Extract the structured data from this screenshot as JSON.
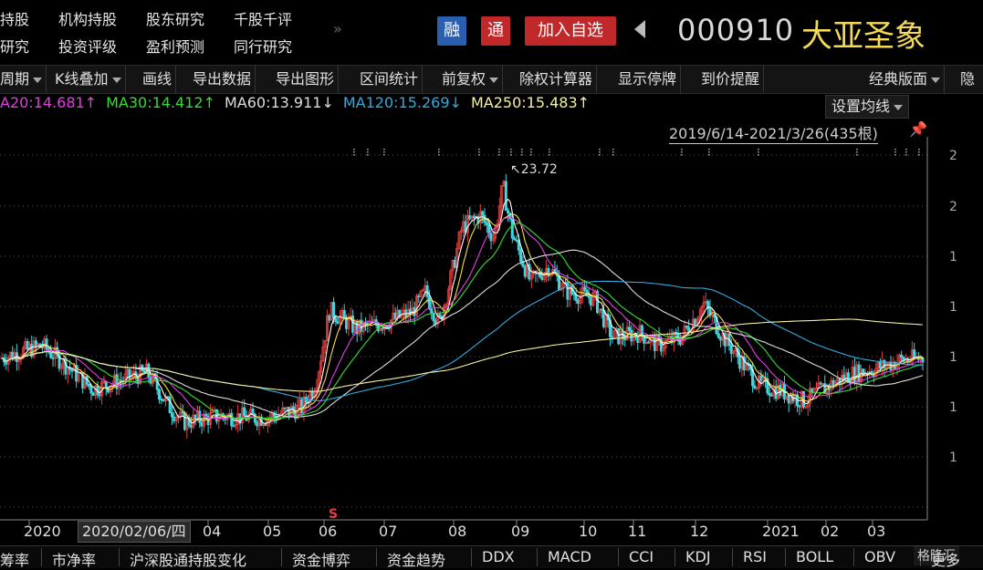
{
  "top_nav": {
    "row1": [
      "持股",
      "机构持股",
      "股东研究",
      "千股千评"
    ],
    "row2": [
      "研究",
      "投资评级",
      "盈利预测",
      "同行研究"
    ],
    "more": "»"
  },
  "badges": {
    "rong": "融",
    "tong": "通",
    "add": "加入自选"
  },
  "stock": {
    "code": "000910",
    "name": "大亚圣象"
  },
  "toolbar": {
    "items": [
      "周期",
      "K线叠加",
      "画线",
      "导出数据",
      "导出图形",
      "区间统计",
      "前复权",
      "除权计算器",
      "显示停牌",
      "到价提醒"
    ],
    "right": "经典版面",
    "far_right": "隐"
  },
  "ma_legend": [
    {
      "text": "A20:14.681↑",
      "color": "#e040e0"
    },
    {
      "text": "MA30:14.412↑",
      "color": "#33dd33"
    },
    {
      "text": "MA60:13.911↓",
      "color": "#dddddd"
    },
    {
      "text": "MA120:15.269↓",
      "color": "#33aadd"
    },
    {
      "text": "MA250:15.483↑",
      "color": "#f5f0a0"
    }
  ],
  "ma_settings": "设置均线",
  "range": "2019/6/14-2021/3/26(435根)",
  "date_tooltip": "2020/02/06/四",
  "chart_data": {
    "type": "candlestick",
    "date_range": [
      "2019/6/14",
      "2021/3/26"
    ],
    "bars": 435,
    "x_tick_labels": [
      "2020",
      "04",
      "05",
      "06",
      "07",
      "08",
      "09",
      "10",
      "11",
      "12",
      "2021",
      "02",
      "03"
    ],
    "y_tick_labels": [
      "2",
      "2",
      "1",
      "1",
      "1",
      "1",
      "1"
    ],
    "annotations": [
      {
        "text": "↖23.72",
        "meaning": "period high"
      }
    ],
    "markers": {
      "bottom": "S"
    },
    "series": [
      {
        "name": "A20",
        "value": 14.681,
        "color": "#e040e0"
      },
      {
        "name": "MA30",
        "value": 14.412,
        "color": "#33dd33"
      },
      {
        "name": "MA60",
        "value": 13.911,
        "color": "#dddddd"
      },
      {
        "name": "MA120",
        "value": 15.269,
        "color": "#33aadd"
      },
      {
        "name": "MA250",
        "value": 15.483,
        "color": "#f5f0a0"
      }
    ],
    "colors": {
      "up": "#e84040",
      "down": "#40d8e0"
    }
  },
  "bottom_tabs": [
    "筹率",
    "市净率",
    "沪深股通持股变化",
    "资金博弈",
    "资金趋势",
    "DDX",
    "MACD",
    "CCI",
    "KDJ",
    "RSI",
    "BOLL",
    "OBV",
    "更多"
  ],
  "watermark": "格隆汇"
}
